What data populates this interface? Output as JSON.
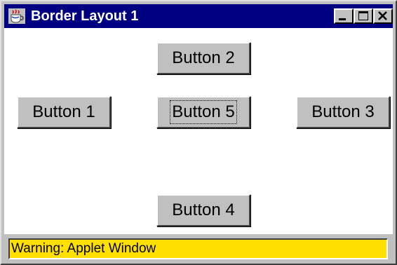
{
  "window": {
    "title": "Border Layout 1",
    "controls": [
      "minimize",
      "maximize",
      "close"
    ],
    "title_bar_color": "#000080"
  },
  "buttons": {
    "north": "Button 2",
    "west": "Button 1",
    "center": "Button 5",
    "east": "Button 3",
    "south": "Button 4"
  },
  "focused_button": "Button 5",
  "status": {
    "warning": "Warning: Applet Window",
    "background": "#ffe000"
  },
  "icons": {
    "app": "java-cup-icon",
    "minimize": "minimize-icon",
    "maximize": "maximize-icon",
    "close": "close-icon"
  }
}
